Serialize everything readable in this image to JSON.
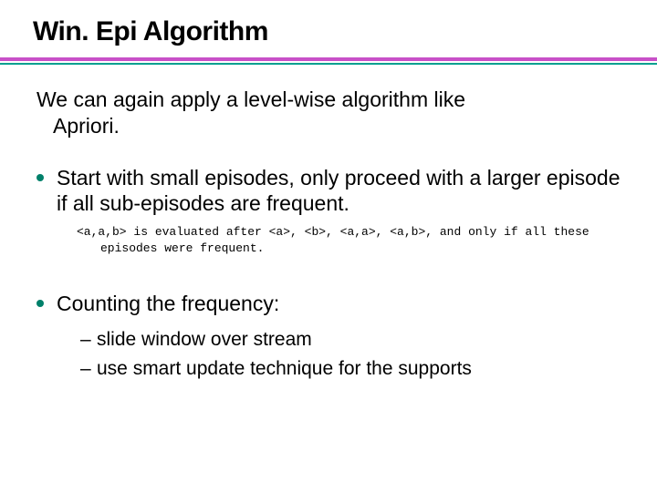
{
  "title": "Win. Epi Algorithm",
  "intro_line1": "We can again apply a level-wise algorithm like",
  "intro_line2": "Apriori.",
  "bullets": [
    {
      "text": "Start with small episodes, only proceed with a larger episode if all sub-episodes are frequent.",
      "mono_line1": "<a,a,b> is evaluated after <a>, <b>, <a,a>, <a,b>, and only if all these",
      "mono_line2": "episodes were frequent."
    },
    {
      "text": "Counting the frequency:",
      "subitems": [
        "slide window over stream",
        "use smart update technique for the supports"
      ]
    }
  ],
  "dash": "–"
}
